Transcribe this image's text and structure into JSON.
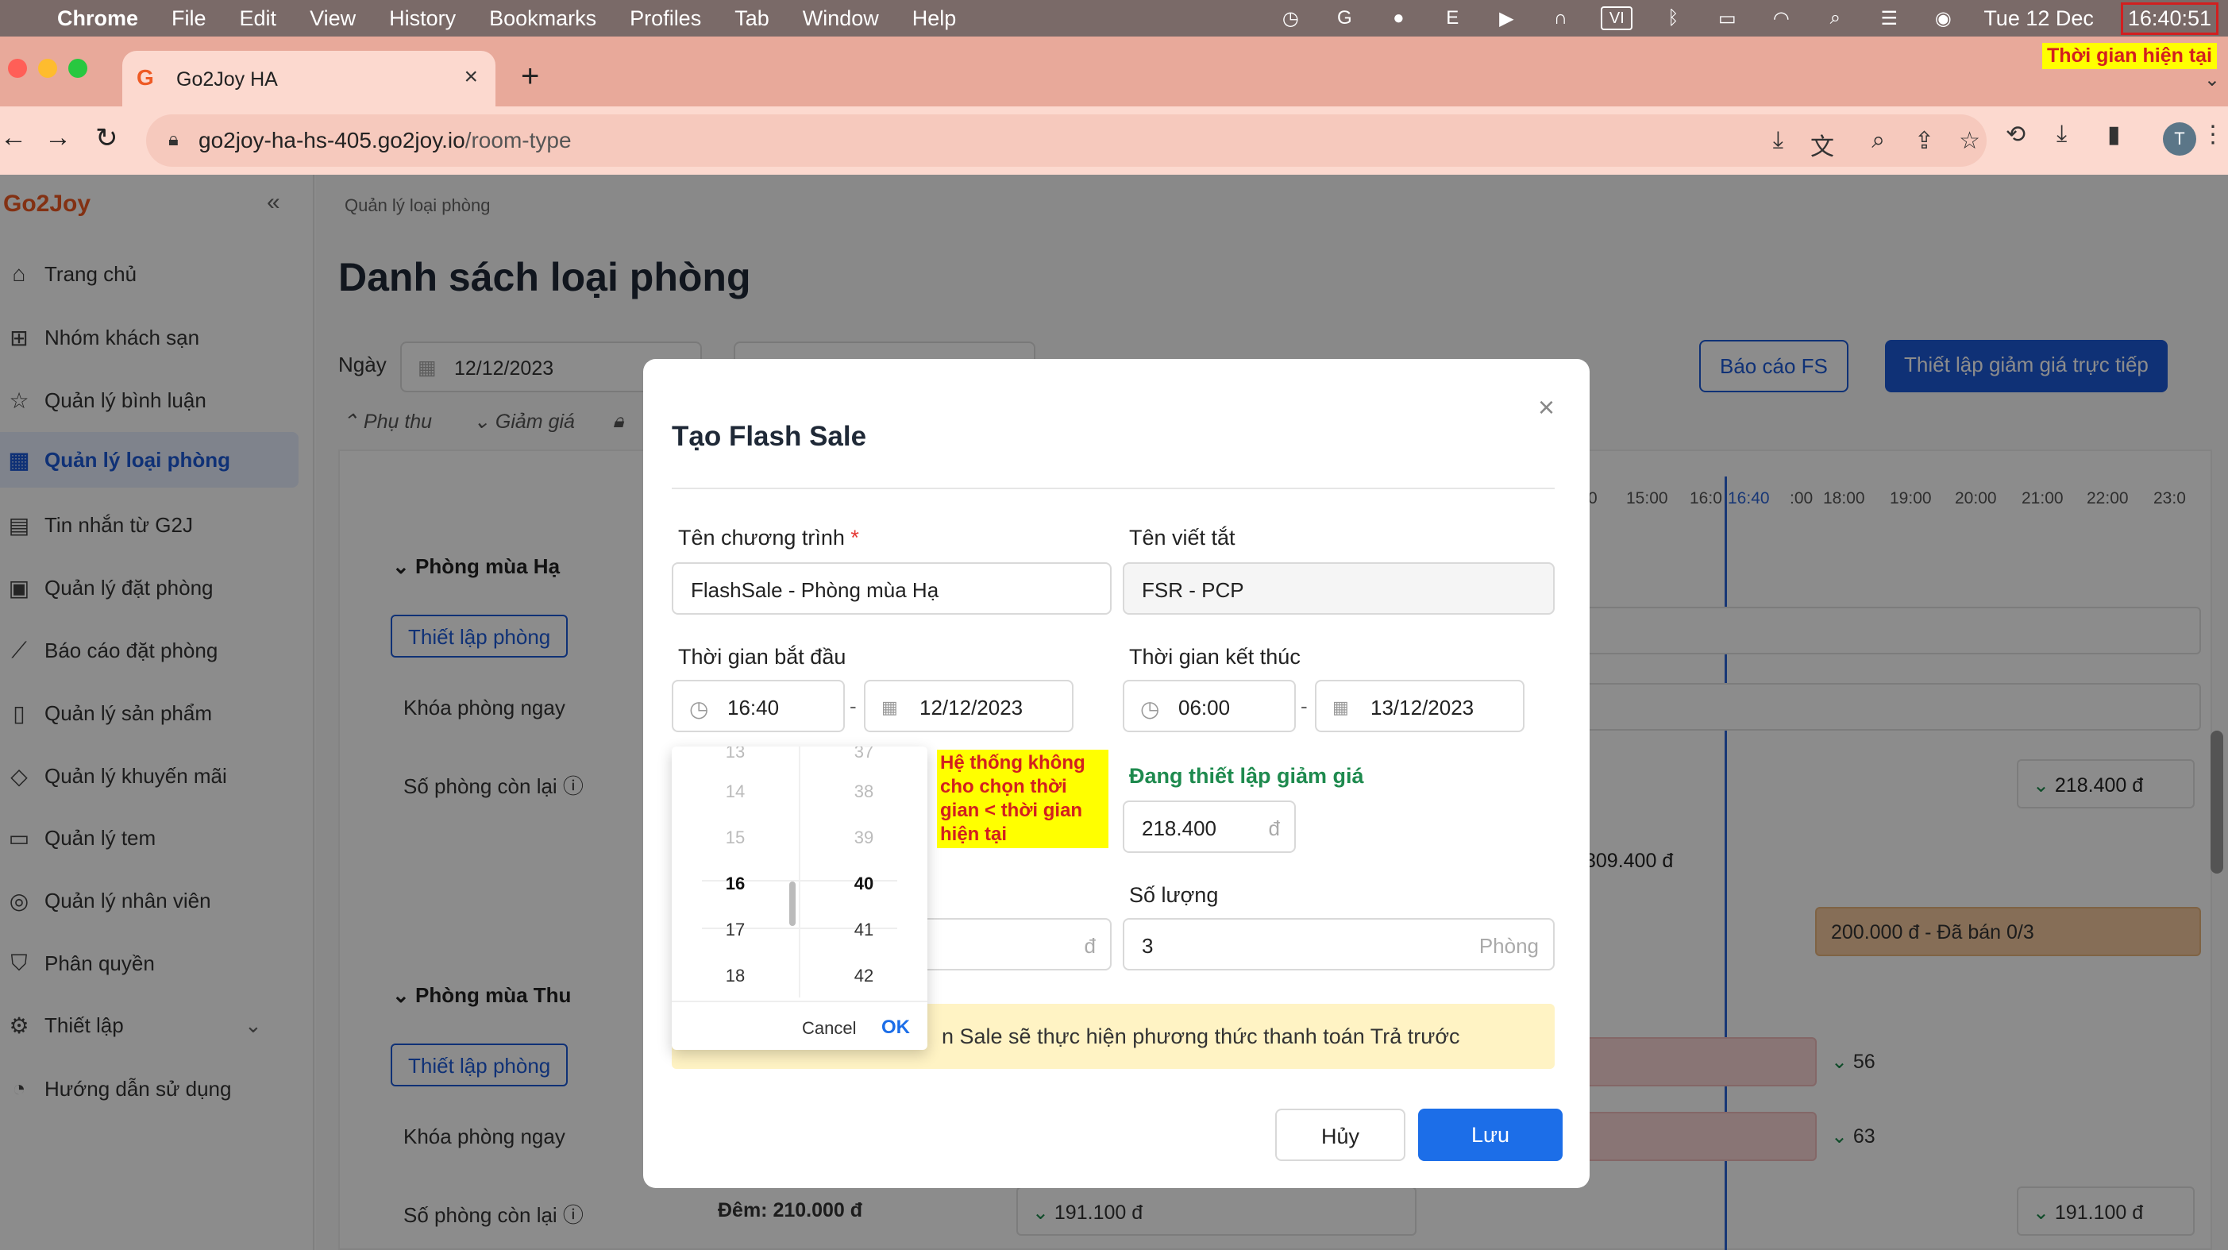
{
  "menubar": {
    "app": "Chrome",
    "items": [
      "File",
      "Edit",
      "View",
      "History",
      "Bookmarks",
      "Profiles",
      "Tab",
      "Window",
      "Help"
    ],
    "input_badge": "VI",
    "date": "Tue 12 Dec",
    "time": "16:40:51"
  },
  "annotations": {
    "now_label": "Thời gian hiện tại",
    "picker_note": "Hệ thống không cho chọn thời gian < thời gian hiện tại"
  },
  "browser": {
    "tab_title": "Go2Joy HA",
    "url_host": "go2joy-ha-hs-405.go2joy.io",
    "url_path": "/room-type",
    "avatar_letter": "T"
  },
  "sidebar": {
    "brand": "Go2Joy",
    "items": [
      {
        "label": "Trang chủ",
        "icon": "home-icon"
      },
      {
        "label": "Nhóm khách sạn",
        "icon": "grid-icon"
      },
      {
        "label": "Quản lý bình luận",
        "icon": "star-icon"
      },
      {
        "label": "Quản lý loại phòng",
        "icon": "building-icon",
        "active": true
      },
      {
        "label": "Tin nhắn từ G2J",
        "icon": "message-icon"
      },
      {
        "label": "Quản lý đặt phòng",
        "icon": "calendar-icon"
      },
      {
        "label": "Báo cáo đặt phòng",
        "icon": "chart-icon"
      },
      {
        "label": "Quản lý sản phẩm",
        "icon": "bottle-icon"
      },
      {
        "label": "Quản lý khuyến mãi",
        "icon": "tag-icon"
      },
      {
        "label": "Quản lý tem",
        "icon": "ticket-icon"
      },
      {
        "label": "Quản lý nhân viên",
        "icon": "user-icon"
      },
      {
        "label": "Phân quyền",
        "icon": "shield-icon"
      },
      {
        "label": "Thiết lập",
        "icon": "gear-icon"
      },
      {
        "label": "Hướng dẫn sử dụng",
        "icon": "compass-icon"
      }
    ]
  },
  "page": {
    "breadcrumb": "Quản lý loại phòng",
    "title": "Danh sách loại phòng",
    "date_label": "Ngày",
    "date_value": "12/12/2023",
    "btn_report": "Báo cáo FS",
    "btn_setup_discount": "Thiết lập giảm giá trực tiếp",
    "legend_surcharge": "Phụ thu",
    "legend_discount": "Giảm giá",
    "hours": [
      "0",
      "15:00",
      "16:0",
      "16:40",
      ":00",
      "18:00",
      "19:00",
      "20:00",
      "21:00",
      "22:00",
      "23:0"
    ],
    "room1": {
      "title": "Phòng mùa Hạ",
      "setup": "Thiết lập phòng",
      "lock": "Khóa phòng ngay",
      "remaining": "Số phòng còn lại ⓘ",
      "price_discount": "218.400 đ",
      "price_1": "309.400 đ",
      "sold": "200.000 đ - Đã bán 0/3"
    },
    "room2": {
      "title": "Phòng mùa Thu",
      "setup": "Thiết lập phòng",
      "lock": "Khóa phòng ngay",
      "remaining": "Số phòng còn lại ⓘ",
      "count_a": "56",
      "count_b": "63",
      "night": "Đêm: 210.000 đ",
      "price_a": "191.100 đ",
      "price_b": "191.100 đ"
    }
  },
  "modal": {
    "title": "Tạo Flash Sale",
    "name_label": "Tên chương trình",
    "name_value": "FlashSale - Phòng mùa Hạ",
    "short_label": "Tên viết tắt",
    "short_value": "FSR - PCP",
    "start_label": "Thời gian bắt đầu",
    "start_time": "16:40",
    "start_date": "12/12/2023",
    "end_label": "Thời gian kết thúc",
    "end_time": "06:00",
    "end_date": "13/12/2023",
    "discount_label": "Đang thiết lập giảm giá",
    "discount_value": "218.400",
    "currency": "đ",
    "qty_label": "Số lượng",
    "qty_value": "3",
    "qty_unit": "Phòng",
    "info_text": "n Sale sẽ thực hiện phương thức thanh toán Trả trước",
    "cancel": "Hủy",
    "save": "Lưu"
  },
  "picker": {
    "hours": [
      "13",
      "14",
      "15",
      "16",
      "17",
      "18"
    ],
    "minutes": [
      "37",
      "38",
      "39",
      "40",
      "41",
      "42"
    ],
    "cancel": "Cancel",
    "ok": "OK"
  },
  "colors": {
    "brand": "#ee5a24",
    "primary": "#1d5ad8",
    "save": "#1c6ee8",
    "annotation_bg": "#ffff00",
    "annotation_text": "#d21f1f"
  }
}
